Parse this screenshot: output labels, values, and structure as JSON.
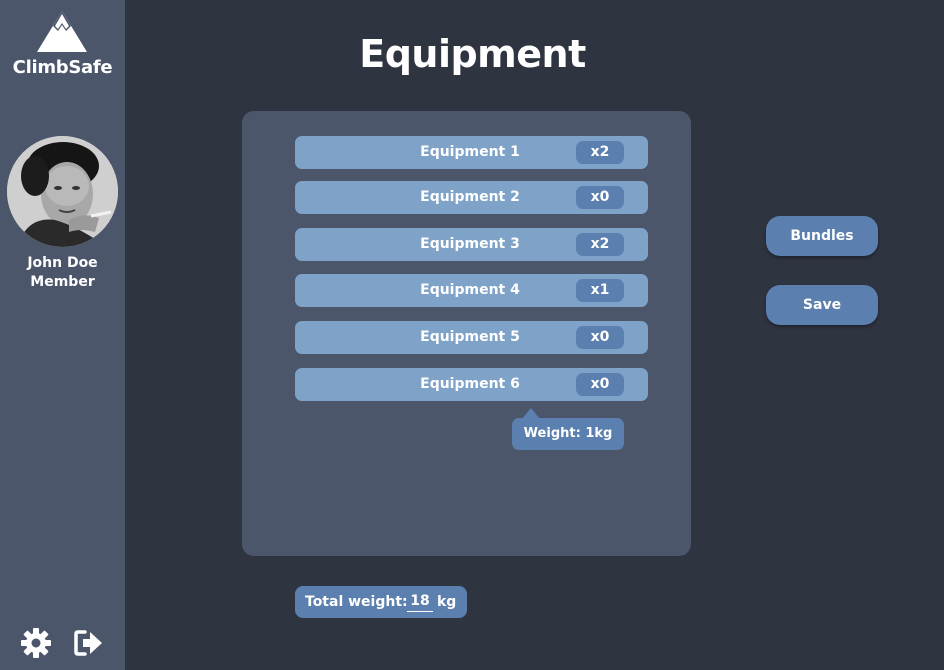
{
  "brand": {
    "name": "ClimbSafe",
    "logo_icon": "mountain-icon"
  },
  "user": {
    "name": "John Doe",
    "role": "Member",
    "avatar": "user-avatar-photo"
  },
  "page": {
    "title": "Equipment"
  },
  "equipment": [
    {
      "label": "Equipment 1",
      "qty": "x2"
    },
    {
      "label": "Equipment 2",
      "qty": "x0"
    },
    {
      "label": "Equipment 3",
      "qty": "x2"
    },
    {
      "label": "Equipment 4",
      "qty": "x1"
    },
    {
      "label": "Equipment 5",
      "qty": "x0"
    },
    {
      "label": "Equipment 6",
      "qty": "x0"
    }
  ],
  "tooltip": {
    "text": "Weight: 1kg"
  },
  "actions": {
    "bundles_label": "Bundles",
    "save_label": "Save"
  },
  "total_weight": {
    "label": "Total weight:",
    "value": "18",
    "unit": "kg"
  },
  "sidebar_icons": {
    "settings": "gear-icon",
    "logout": "logout-icon"
  },
  "colors": {
    "background": "#2f3441",
    "sidebar": "#4b566b",
    "panel": "#4b566b",
    "row": "#7fa3c8",
    "accent": "#5b7fae",
    "text": "#ffffff"
  }
}
